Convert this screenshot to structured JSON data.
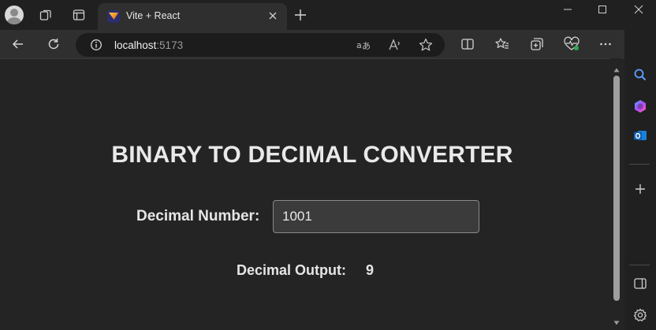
{
  "browser": {
    "tab": {
      "title": "Vite + React"
    },
    "address": {
      "host": "localhost",
      "port": ":5173"
    }
  },
  "page": {
    "heading": "BINARY TO DECIMAL CONVERTER",
    "input_label": "Decimal Number:",
    "input_value": "1001",
    "output_label": "Decimal Output:",
    "output_value": "9"
  },
  "icons": {
    "tabstrip": [
      "profile-avatar",
      "workspaces-icon",
      "tab-actions-icon",
      "vite-favicon",
      "close-icon",
      "new-tab-icon",
      "minimize-icon",
      "maximize-icon",
      "window-close-icon"
    ],
    "toolbar": [
      "back-icon",
      "refresh-icon",
      "site-info-icon",
      "translate-icon",
      "read-aloud-icon",
      "favorite-star-icon",
      "split-screen-icon",
      "favorites-icon",
      "collections-icon",
      "browser-essentials-icon",
      "more-menu-icon",
      "copilot-icon"
    ],
    "sidebar": [
      "search-icon",
      "copilot-sidebar-icon",
      "outlook-icon",
      "add-icon",
      "sidebar-toggle-icon",
      "settings-icon"
    ]
  },
  "colors": {
    "page_background": "#242424",
    "chrome_background": "#202020",
    "toolbar_background": "#2f2f2f",
    "text": "#e6e6e6",
    "input_background": "#3b3b3b"
  }
}
